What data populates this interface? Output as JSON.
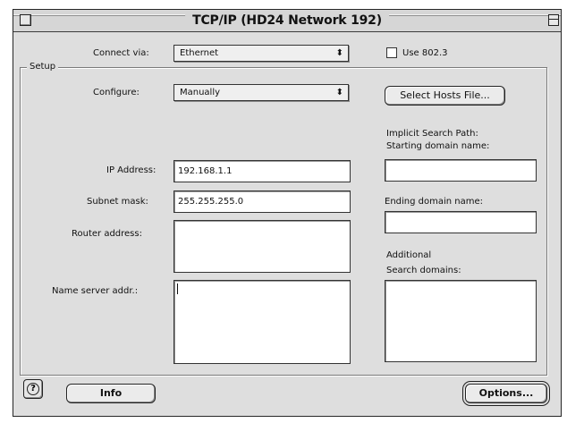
{
  "window": {
    "title": "TCP/IP (HD24 Network 192)"
  },
  "connect": {
    "label": "Connect via:",
    "value": "Ethernet",
    "use8023_label": "Use 802.3",
    "use8023_checked": false
  },
  "setup": {
    "group_label": "Setup",
    "configure_label": "Configure:",
    "configure_value": "Manually",
    "select_hosts_label": "Select Hosts File...",
    "ip_label": "IP Address:",
    "ip_value": "192.168.1.1",
    "subnet_label": "Subnet mask:",
    "subnet_value": "255.255.255.0",
    "router_label": "Router address:",
    "router_value": "",
    "nameserver_label": "Name server addr.:",
    "nameserver_value": "",
    "implicit_label": "Implicit Search Path:",
    "starting_label": "Starting domain name:",
    "starting_value": "",
    "ending_label": "Ending domain name:",
    "ending_value": "",
    "additional_label_1": "Additional",
    "additional_label_2": "Search domains:",
    "additional_value": ""
  },
  "footer": {
    "help_symbol": "?",
    "info_label": "Info",
    "options_label": "Options..."
  },
  "icons": {
    "popup_arrows": "⬍"
  }
}
